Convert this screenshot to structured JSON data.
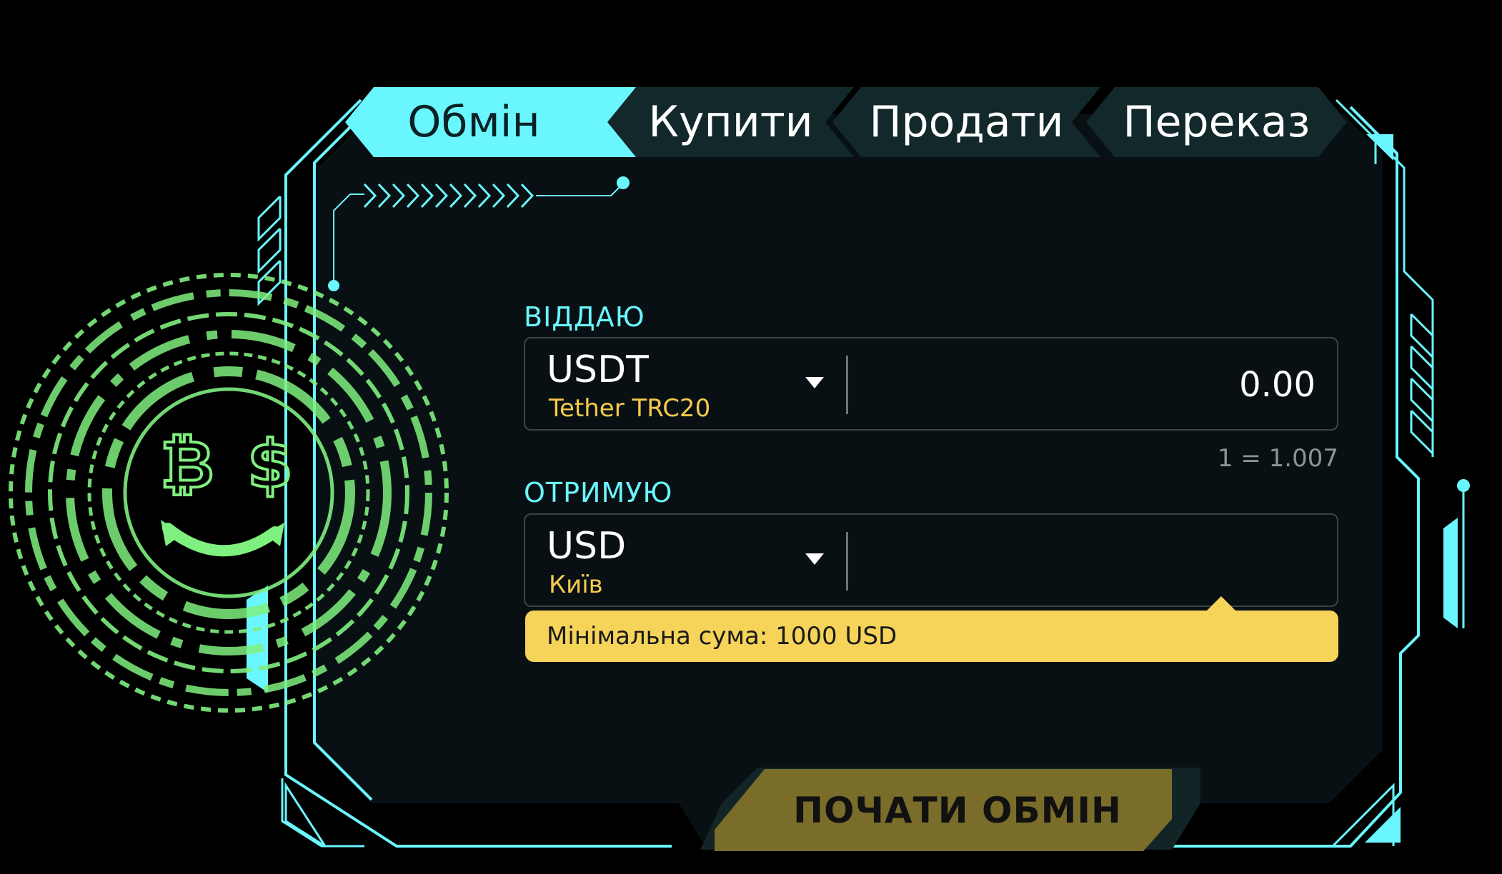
{
  "tabs": [
    {
      "label": "Обмін",
      "active": true
    },
    {
      "label": "Купити",
      "active": false
    },
    {
      "label": "Продати",
      "active": false
    },
    {
      "label": "Переказ",
      "active": false
    }
  ],
  "give": {
    "label": "ВІДДАЮ",
    "currency_code": "USDT",
    "currency_network": "Tether TRC20",
    "amount": "0.00",
    "rate": "1 = 1.007"
  },
  "receive": {
    "label": "ОТРИМУЮ",
    "currency_code": "USD",
    "currency_network": "Київ",
    "amount": ""
  },
  "notice": "Мінімальна сума: 1000 USD",
  "start_button": "ПОЧАТИ ОБМІН",
  "decor_icons": [
    "bitcoin-icon",
    "dollar-icon",
    "smile-arc-icon"
  ],
  "colors": {
    "accent_cyan": "#6af6ff",
    "green_ring": "#7ff07f",
    "label_yellow": "#f5c94d",
    "notice_yellow": "#f6d45a",
    "button_olive": "#7a6d2a",
    "panel_bg": "#081013",
    "tab_bg": "#12282b"
  }
}
